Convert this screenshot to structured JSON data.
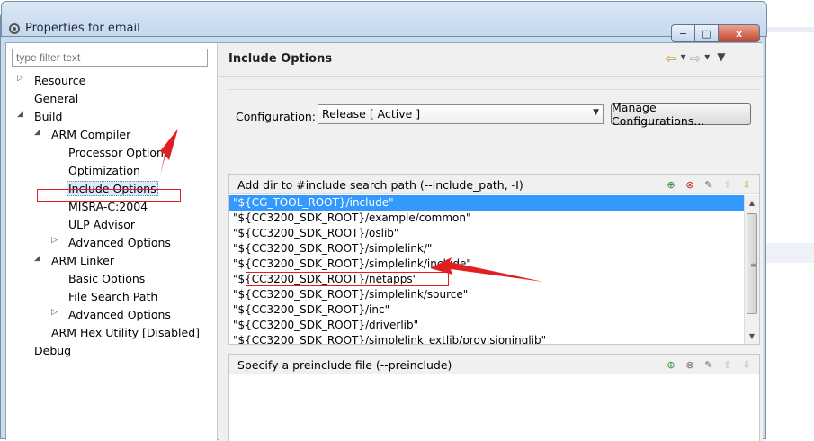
{
  "window": {
    "title": "Properties for email",
    "minimize_glyph": "−",
    "maximize_glyph": "□",
    "close_glyph": "x"
  },
  "filter": {
    "placeholder": "type filter text"
  },
  "tree": {
    "resource": "Resource",
    "general": "General",
    "build": "Build",
    "arm_compiler": "ARM Compiler",
    "processor_options": "Processor Options",
    "optimization": "Optimization",
    "include_options": "Include Options",
    "misra": "MISRA-C:2004",
    "ulp_advisor": "ULP Advisor",
    "advanced_options_compiler": "Advanced Options",
    "arm_linker": "ARM Linker",
    "basic_options": "Basic Options",
    "file_search_path": "File Search Path",
    "advanced_options_linker": "Advanced Options",
    "arm_hex_utility": "ARM Hex Utility  [Disabled]",
    "debug": "Debug"
  },
  "page": {
    "title": "Include Options"
  },
  "configuration": {
    "label": "Configuration:",
    "selected": "Release  [ Active ]",
    "manage_button": "Manage Configurations..."
  },
  "include_paths": {
    "header": "Add dir to #include search path (--include_path, -I)",
    "items": [
      "\"${CG_TOOL_ROOT}/include\"",
      "\"${CC3200_SDK_ROOT}/example/common\"",
      "\"${CC3200_SDK_ROOT}/oslib\"",
      "\"${CC3200_SDK_ROOT}/simplelink/\"",
      "\"${CC3200_SDK_ROOT}/simplelink/include\"",
      "\"${CC3200_SDK_ROOT}/netapps\"",
      "\"${CC3200_SDK_ROOT}/simplelink/source\"",
      "\"${CC3200_SDK_ROOT}/inc\"",
      "\"${CC3200_SDK_ROOT}/driverlib\"",
      "\"${CC3200_SDK_ROOT}/simplelink_extlib/provisioninglib\""
    ]
  },
  "preinclude": {
    "header": "Specify a preinclude file (--preinclude)"
  },
  "colors": {
    "selection": "#3399ff",
    "annotation": "#e02020"
  }
}
